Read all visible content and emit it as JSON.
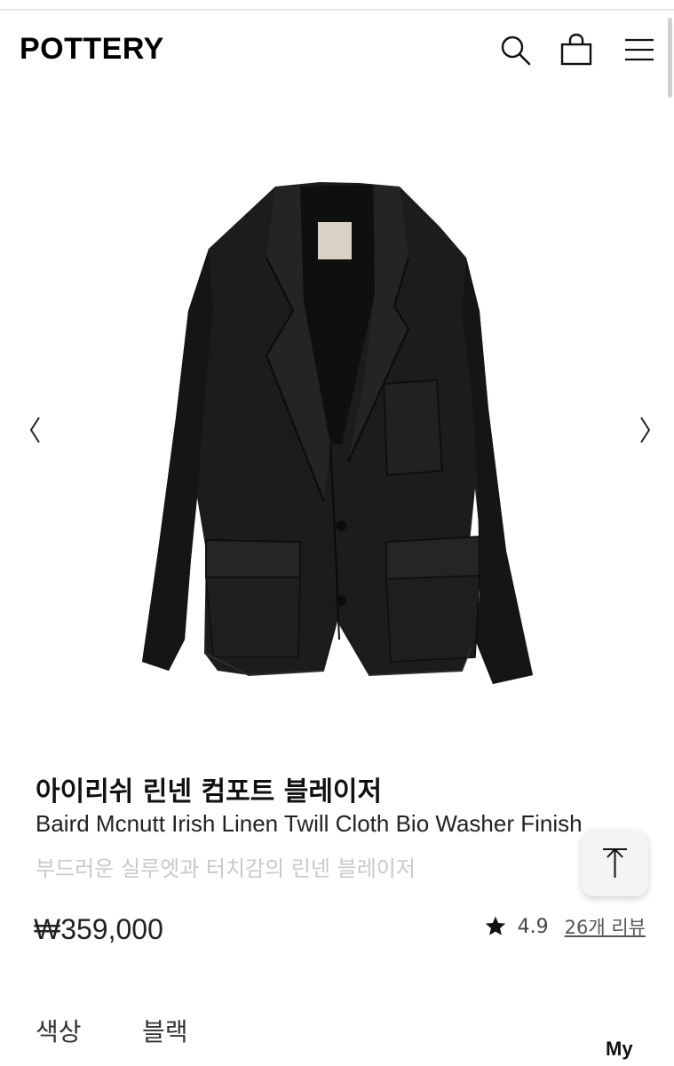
{
  "header": {
    "logo": "POTTERY"
  },
  "icons": {
    "search": "search-icon",
    "bag": "shopping-bag-icon",
    "menu": "menu-icon",
    "prev": "chevron-left-icon",
    "next": "chevron-right-icon",
    "top": "scroll-to-top-icon",
    "star": "star-icon"
  },
  "product": {
    "title_ko": "아이리쉬 린넨 컴포트 블레이저",
    "title_en": "Baird Mcnutt Irish Linen Twill Cloth Bio Washer Finish",
    "subtitle": "부드러운 실루엣과 터치감의 린넨 블레이저",
    "price": "₩359,000",
    "rating": "4.9",
    "reviews": "26개 리뷰",
    "option_label": "색상",
    "option_value": "블랙"
  },
  "footer": {
    "my": "My"
  },
  "colors": {
    "text": "#111111",
    "muted": "#c9c9c9",
    "jacket": "#1b1b1c"
  }
}
